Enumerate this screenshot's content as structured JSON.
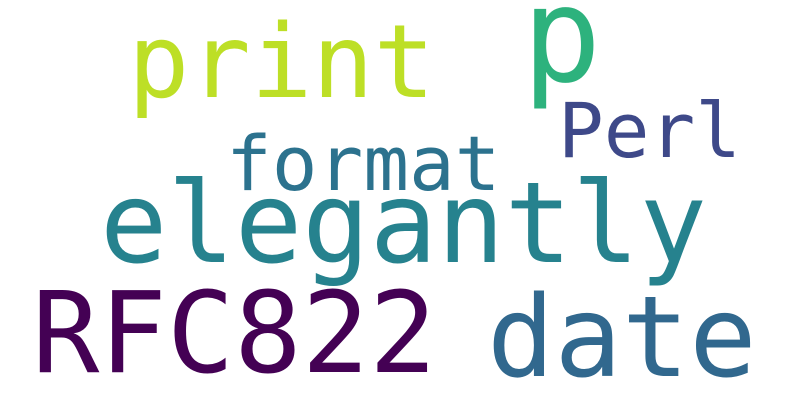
{
  "words": [
    {
      "id": "rfc",
      "text": "RFC822",
      "color": "#440154"
    },
    {
      "id": "date",
      "text": "date",
      "color": "#31688e"
    },
    {
      "id": "elegantly",
      "text": "elegantly",
      "color": "#26828e"
    },
    {
      "id": "print",
      "text": "print",
      "color": "#bddf26"
    },
    {
      "id": "p",
      "text": "p",
      "color": "#2db27d"
    },
    {
      "id": "format",
      "text": "format",
      "color": "#2c728e"
    },
    {
      "id": "perl",
      "text": "Perl",
      "color": "#3e4989"
    }
  ]
}
